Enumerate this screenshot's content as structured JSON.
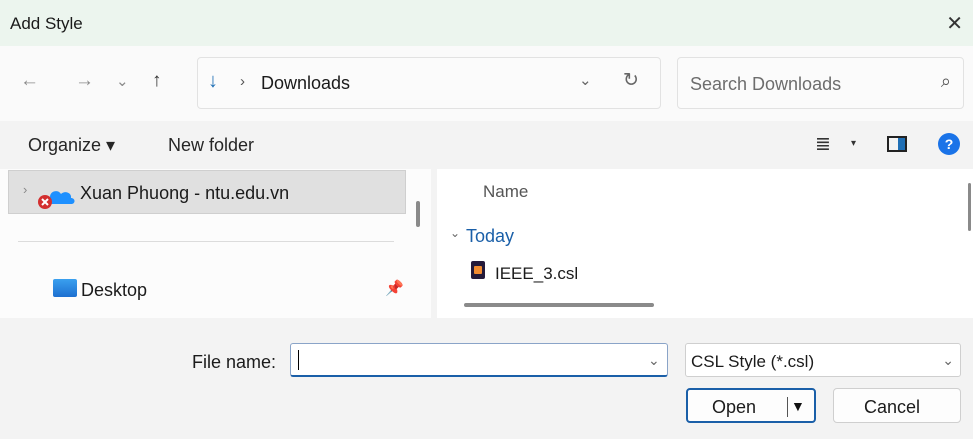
{
  "window": {
    "title": "Add Style",
    "close_glyph": "✕"
  },
  "nav": {
    "back_glyph": "←",
    "forward_glyph": "→",
    "recent_glyph": "⌄",
    "up_glyph": "↑",
    "address": {
      "location_icon": "download-arrow-icon",
      "location_glyph": "↓",
      "separator": "›",
      "location": "Downloads",
      "dropdown_glyph": "⌄",
      "refresh_glyph": "↻"
    },
    "search": {
      "placeholder": "Search Downloads",
      "icon_glyph": "⌕"
    }
  },
  "command_bar": {
    "organize_label": "Organize ▾",
    "new_folder_label": "New folder",
    "view_glyph": "≣",
    "view_caret": "▾",
    "help_glyph": "?"
  },
  "nav_pane": {
    "items": [
      {
        "label": "Xuan Phuong - ntu.edu.vn",
        "chevron": "›",
        "selected": true,
        "icon": "onedrive-icon"
      },
      {
        "label": "Desktop",
        "pin_glyph": "📌",
        "icon": "desktop-icon"
      }
    ]
  },
  "file_list": {
    "column_header": "Name",
    "groups": [
      {
        "chevron": "⌄",
        "label": "Today",
        "files": [
          {
            "name": "IEEE_3.csl",
            "icon": "csl-file-icon"
          }
        ]
      }
    ]
  },
  "footer": {
    "file_name_label": "File name:",
    "file_name_value": "",
    "file_name_dropdown_glyph": "⌄",
    "file_type": {
      "selected": "CSL Style (*.csl)",
      "dropdown_glyph": "⌄"
    },
    "open_label": "Open",
    "open_arrow": "▼",
    "cancel_label": "Cancel"
  },
  "colors": {
    "accent": "#1a5fa8",
    "title_bg": "#ecf5ee",
    "help": "#1a73e8",
    "onedrive": "#1e90ff",
    "error_badge": "#d32f2f"
  }
}
